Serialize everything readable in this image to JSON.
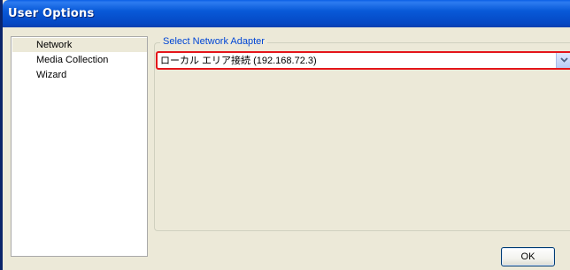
{
  "window": {
    "title": "User Options"
  },
  "sidebar": {
    "items": [
      {
        "label": "Network",
        "selected": true
      },
      {
        "label": "Media Collection",
        "selected": false
      },
      {
        "label": "Wizard",
        "selected": false
      }
    ]
  },
  "network": {
    "group_label": "Select Network Adapter",
    "adapter_value": "ローカル エリア接続 (192.168.72.3)"
  },
  "buttons": {
    "ok_label": "OK"
  },
  "colors": {
    "titlebar": "#0859d8",
    "legend_text": "#0046d5",
    "highlight_border": "#e4151a",
    "window_bg": "#ece9d8"
  },
  "icons": {
    "dropdown": "chevron-down-icon"
  }
}
